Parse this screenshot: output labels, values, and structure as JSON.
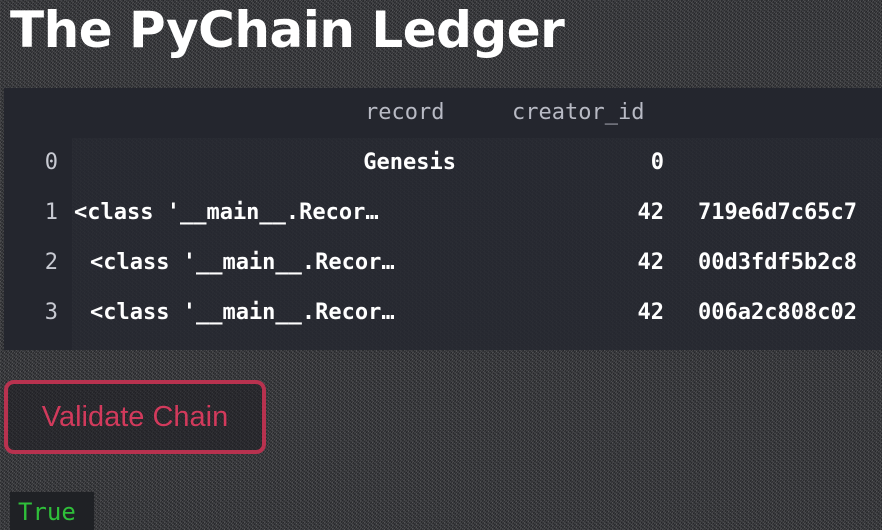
{
  "page": {
    "title": "The PyChain Ledger"
  },
  "table": {
    "columns": [
      "record",
      "creator_id"
    ],
    "rows": [
      {
        "index": "0",
        "record": "Genesis",
        "creator_id": "0",
        "hash": ""
      },
      {
        "index": "1",
        "record": "<class '__main__.Recor…",
        "creator_id": "42",
        "hash": "719e6d7c65c7"
      },
      {
        "index": "2",
        "record": "<class '__main__.Recor…",
        "creator_id": "42",
        "hash": "00d3fdf5b2c8"
      },
      {
        "index": "3",
        "record": "<class '__main__.Recor…",
        "creator_id": "42",
        "hash": "006a2c808c02"
      }
    ]
  },
  "actions": {
    "validate_label": "Validate Chain"
  },
  "output": {
    "result": "True"
  },
  "colors": {
    "button_accent": "#d23a5c",
    "result_text": "#2fbf3a"
  }
}
